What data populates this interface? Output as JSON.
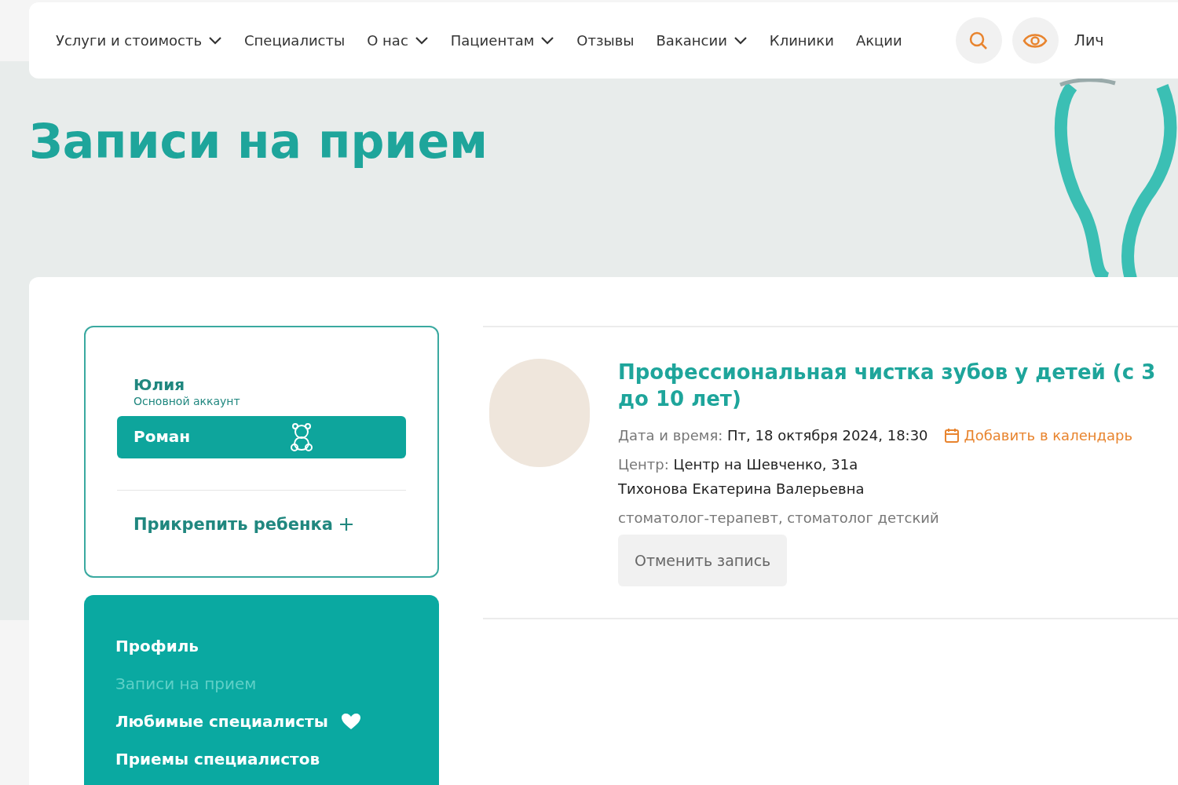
{
  "nav": {
    "items": [
      {
        "label": "Услуги и стоимость",
        "has_dropdown": true
      },
      {
        "label": "Специалисты",
        "has_dropdown": false
      },
      {
        "label": "О нас",
        "has_dropdown": true
      },
      {
        "label": "Пациентам",
        "has_dropdown": true
      },
      {
        "label": "Отзывы",
        "has_dropdown": false
      },
      {
        "label": "Вакансии",
        "has_dropdown": true
      },
      {
        "label": "Клиники",
        "has_dropdown": false
      },
      {
        "label": "Акции",
        "has_dropdown": false
      }
    ],
    "account_link": "Лич"
  },
  "page_title": "Записи на прием",
  "accounts": {
    "items": [
      {
        "name": "Юлия",
        "subtitle": "Основной аккаунт",
        "kind": "main",
        "selected": false
      },
      {
        "name": "Роман",
        "kind": "child",
        "selected": true
      }
    ],
    "attach_child": "Прикрепить ребенка"
  },
  "menu": {
    "items": [
      {
        "label": "Профиль",
        "selected": false,
        "favorite": false
      },
      {
        "label": "Записи на прием",
        "selected": true,
        "favorite": false
      },
      {
        "label": "Любимые специалисты",
        "selected": false,
        "favorite": true
      },
      {
        "label": "Приемы специалистов",
        "selected": false,
        "favorite": false
      }
    ]
  },
  "appointment": {
    "title": "Профессиональная чистка зубов у детей (с 3 до 10 лет)",
    "datetime_label": "Дата и время:",
    "datetime": "Пт, 18 октября 2024, 18:30",
    "add_to_calendar": "Добавить в календарь",
    "center_label": "Центр:",
    "center": "Центр на Шевченко, 31а",
    "doctor": "Тихонова Екатерина Валерьевна",
    "specialty": "стоматолог-терапевт, стоматолог детский",
    "cancel_button": "Отменить запись"
  }
}
